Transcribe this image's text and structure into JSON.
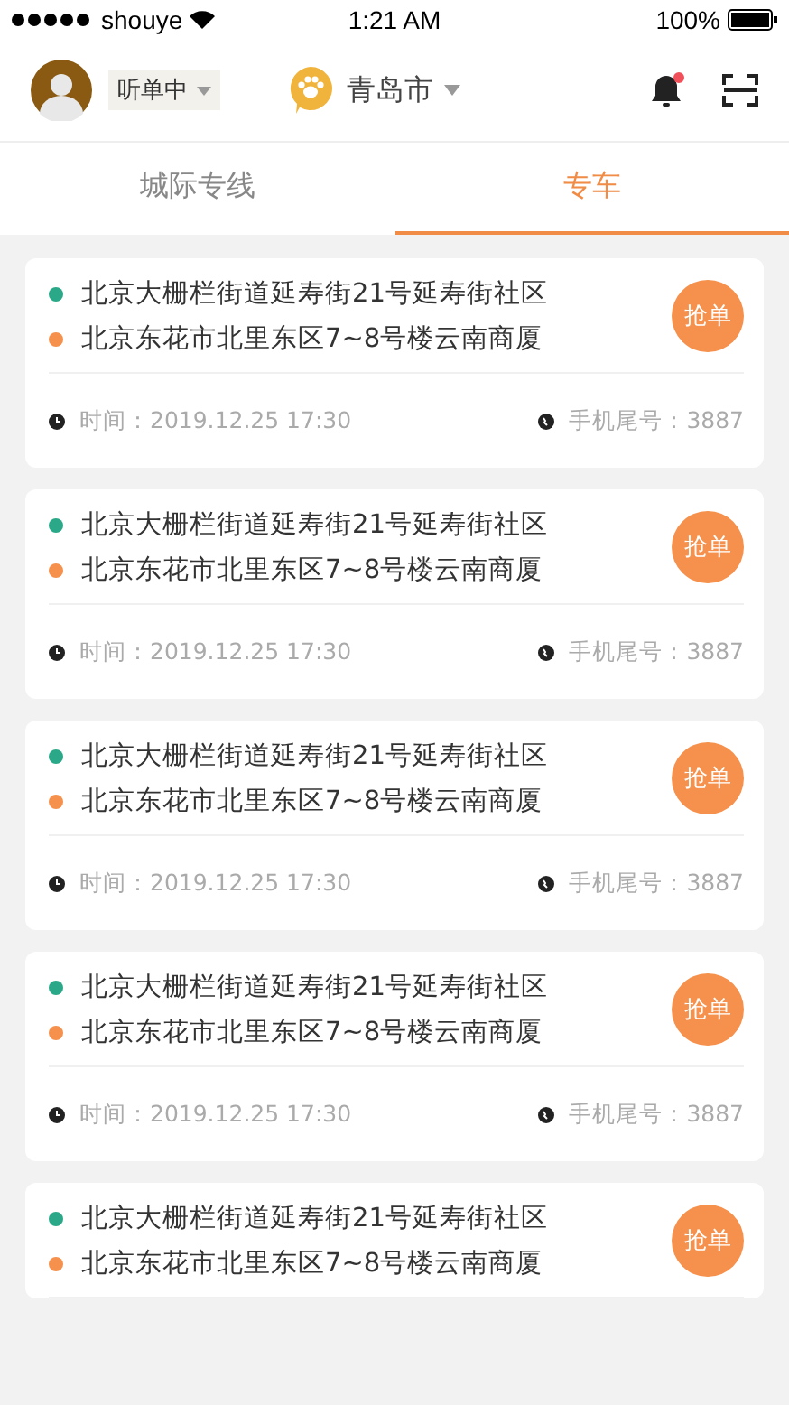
{
  "status_bar": {
    "carrier": "shouye",
    "time": "1:21 AM",
    "battery": "100%"
  },
  "header": {
    "status": "听单中",
    "city": "青岛市",
    "notification_dot": true
  },
  "tabs": [
    {
      "label": "城际专线",
      "selected": false
    },
    {
      "label": "专车",
      "selected": true
    }
  ],
  "orders": [
    {
      "from": "北京大栅栏街道延寿街21号延寿街社区",
      "to": "北京东花市北里东区7~8号楼云南商厦",
      "button": "抢单",
      "time": "时间：2019.12.25 17:30",
      "phone": "手机尾号：3887"
    },
    {
      "from": "北京大栅栏街道延寿街21号延寿街社区",
      "to": "北京东花市北里东区7~8号楼云南商厦",
      "button": "抢单",
      "time": "时间：2019.12.25 17:30",
      "phone": "手机尾号：3887"
    },
    {
      "from": "北京大栅栏街道延寿街21号延寿街社区",
      "to": "北京东花市北里东区7~8号楼云南商厦",
      "button": "抢单",
      "time": "时间：2019.12.25 17:30",
      "phone": "手机尾号：3887"
    },
    {
      "from": "北京大栅栏街道延寿街21号延寿街社区",
      "to": "北京东花市北里东区7~8号楼云南商厦",
      "button": "抢单",
      "time": "时间：2019.12.25 17:30",
      "phone": "手机尾号：3887"
    },
    {
      "from": "北京大栅栏街道延寿街21号延寿街社区",
      "to": "北京东花市北里东区7~8号楼云南商厦",
      "button": "抢单"
    }
  ]
}
